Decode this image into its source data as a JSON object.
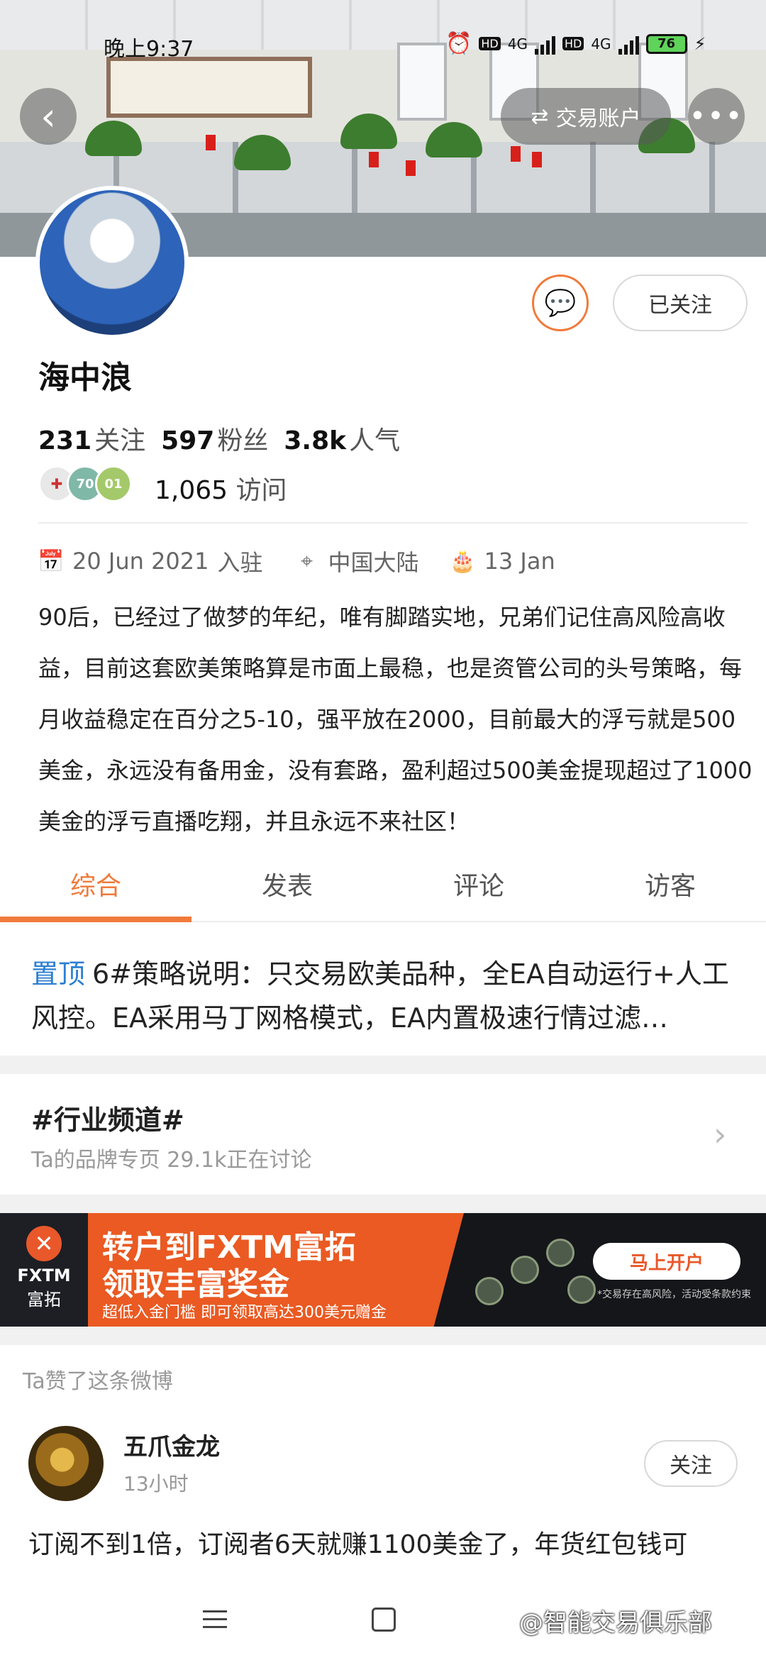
{
  "status_bar": {
    "time": "晚上9:37",
    "network_1": "4G",
    "network_2": "4G",
    "hd": "HD",
    "battery": "76"
  },
  "header": {
    "back_icon": "back-arrow-icon",
    "account_label": "交易账户",
    "account_icon": "swap-icon",
    "more_icon": "more-dots-icon"
  },
  "profile": {
    "name": "海中浪",
    "follow_button": "已关注",
    "message_icon": "message-icon",
    "stats": [
      {
        "value": "231",
        "label": "关注"
      },
      {
        "value": "597",
        "label": "粉丝"
      },
      {
        "value": "3.8k",
        "label": "人气"
      }
    ],
    "badges": [
      "70",
      "01"
    ],
    "visits_value": "1,065",
    "visits_label": "访问",
    "joined_date": "20 Jun 2021",
    "joined_label": "入驻",
    "location": "中国大陆",
    "birthday": "13 Jan",
    "bio": "90后，已经过了做梦的年纪，唯有脚踏实地，兄弟们记住高风险高收益，目前这套欧美策略算是市面上最稳，也是资管公司的头号策略，每月收益稳定在百分之5-10，强平放在2000，目前最大的浮亏就是500美金，永远没有备用金，没有套路，盈利超过500美金提现超过了1000美金的浮亏直播吃翔，并且永远不来社区！"
  },
  "tabs": [
    {
      "label": "综合",
      "active": true
    },
    {
      "label": "发表",
      "active": false
    },
    {
      "label": "评论",
      "active": false
    },
    {
      "label": "访客",
      "active": false
    }
  ],
  "pinned": {
    "tag": "置顶",
    "text": "6#策略说明：只交易欧美品种，全EA自动运行+人工风控。EA采用马丁网格模式，EA内置极速行情过滤…"
  },
  "channel": {
    "title": "#行业频道#",
    "subtitle": "Ta的品牌专页  29.1k正在讨论"
  },
  "ad": {
    "logo_top": "FXTM",
    "logo_bottom": "富拓",
    "headline_1": "转户到FXTM富拓",
    "headline_2": "领取丰富奖金",
    "subline": "超低入金门槛 即可领取高达300美元赠金",
    "button": "马上开户",
    "disclaimer": "*交易存在高风险，活动受条款约束",
    "accent_color": "#ea5a22"
  },
  "liked_post": {
    "header": "Ta赞了这条微博",
    "author": "五爪金龙",
    "time": "13小时",
    "follow_button": "关注",
    "text": "订阅不到1倍，订阅者6天就赚1100美金了，年货红包钱可"
  },
  "watermark": "@智能交易俱乐部"
}
